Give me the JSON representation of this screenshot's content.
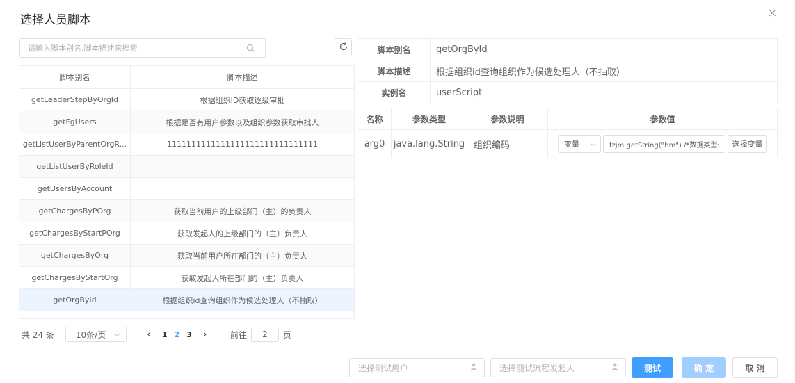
{
  "dialog": {
    "title": "选择人员脚本"
  },
  "search": {
    "placeholder": "请输入脚本别名,脚本描述来搜索"
  },
  "left_table": {
    "headers": [
      "脚本别名",
      "脚本描述"
    ],
    "rows": [
      {
        "alias": "getLeaderStepByOrgId",
        "desc": "根据组织ID获取逐级审批"
      },
      {
        "alias": "getFgUsers",
        "desc": "根据是否有用户参数以及组织参数获取审批人"
      },
      {
        "alias": "getListUserByParentOrgR...",
        "desc": "1111111111111111111111111111111"
      },
      {
        "alias": "getListUserByRoleId",
        "desc": ""
      },
      {
        "alias": "getUsersByAccount",
        "desc": ""
      },
      {
        "alias": "getChargesByPOrg",
        "desc": "获取当前用户的上级部门（主）的负责人"
      },
      {
        "alias": "getChargesByStartPOrg",
        "desc": "获取发起人的上级部门的（主）负责人"
      },
      {
        "alias": "getChargesByOrg",
        "desc": "获取当前用户所在部门的（主）负责人"
      },
      {
        "alias": "getChargesByStartOrg",
        "desc": "获取发起人所在部门的（主）负责人"
      },
      {
        "alias": "getOrgById",
        "desc": "根据组织id查询组织作为候选处理人（不抽取）"
      }
    ]
  },
  "pager": {
    "total": "共 24 条",
    "page_size": "10条/页",
    "prev": "‹",
    "pages": [
      "1",
      "2",
      "3"
    ],
    "next": "›",
    "goto_label": "前往",
    "goto_value": "2",
    "goto_suffix": "页"
  },
  "detail": {
    "alias_label": "脚本别名",
    "alias_value": "getOrgById",
    "desc_label": "脚本描述",
    "desc_value": "根据组织id查询组织作为候选处理人（不抽取）",
    "instance_label": "实例名",
    "instance_value": "userScript"
  },
  "params": {
    "headers": [
      "名称",
      "参数类型",
      "参数说明",
      "参数值"
    ],
    "row": {
      "name": "arg0",
      "type": "java.lang.String",
      "description": "组织编码",
      "value_type": "变量",
      "value": "fzjm.getString(\"bm\") /*数据类型:",
      "choose_label": "选择变量"
    }
  },
  "footer": {
    "test_user_placeholder": "选择测试用户",
    "test_starter_placeholder": "选择测试流程发起人",
    "test_label": "测试",
    "confirm_label": "确 定",
    "cancel_label": "取 消"
  },
  "colors": {
    "primary": "#409eff",
    "primary_disabled": "#a0cfff",
    "selected_row": "#ecf5ff",
    "border": "#dcdfe6"
  },
  "icons": [
    "close-icon",
    "search-icon",
    "refresh-icon",
    "chevron-down-icon",
    "user-icon"
  ]
}
